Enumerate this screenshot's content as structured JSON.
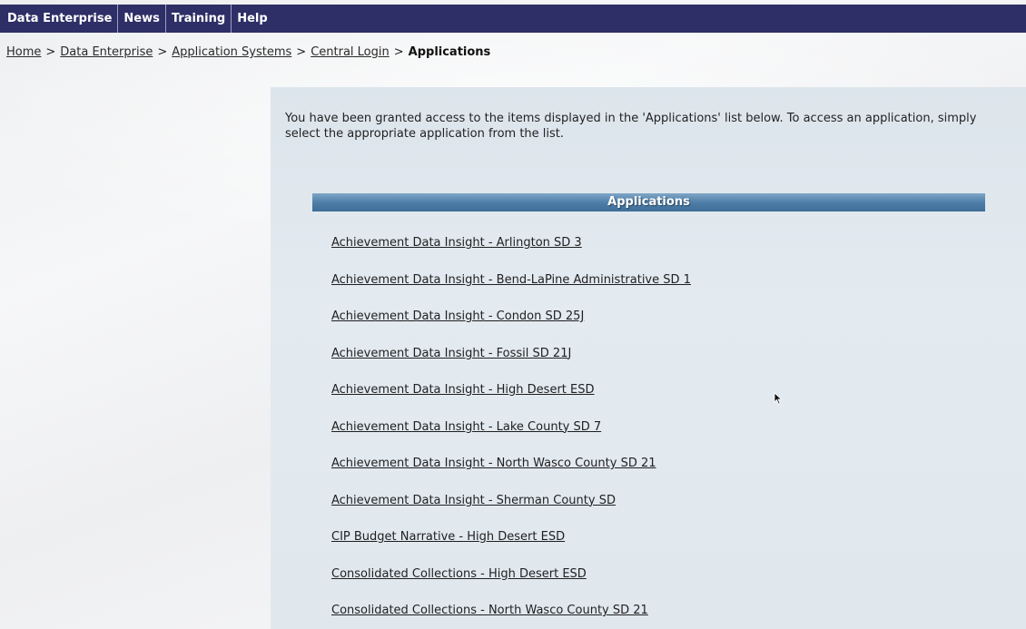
{
  "topnav": {
    "items": [
      "Data Enterprise",
      "News",
      "Training",
      "Help"
    ]
  },
  "breadcrumb": {
    "links": [
      "Home",
      "Data Enterprise",
      "Application Systems",
      "Central Login"
    ],
    "separator": ">",
    "current": "Applications"
  },
  "intro_text": "You have been granted access to the items displayed in the 'Applications' list below.  To access an application, simply select the appropriate application from the list.",
  "applications": {
    "header": "Applications",
    "items": [
      "Achievement Data Insight - Arlington SD 3",
      "Achievement Data Insight - Bend-LaPine Administrative SD 1",
      "Achievement Data Insight - Condon SD 25J",
      "Achievement Data Insight - Fossil SD 21J",
      "Achievement Data Insight - High Desert ESD",
      "Achievement Data Insight - Lake County SD 7",
      "Achievement Data Insight - North Wasco County SD 21",
      "Achievement Data Insight - Sherman County SD",
      "CIP Budget Narrative - High Desert ESD",
      "Consolidated Collections - High Desert ESD",
      "Consolidated Collections - North Wasco County SD 21"
    ]
  },
  "colors": {
    "nav_bar": "#2e2f66",
    "panel": "#dfe7ee",
    "header_bar": "#4f7fa8"
  }
}
